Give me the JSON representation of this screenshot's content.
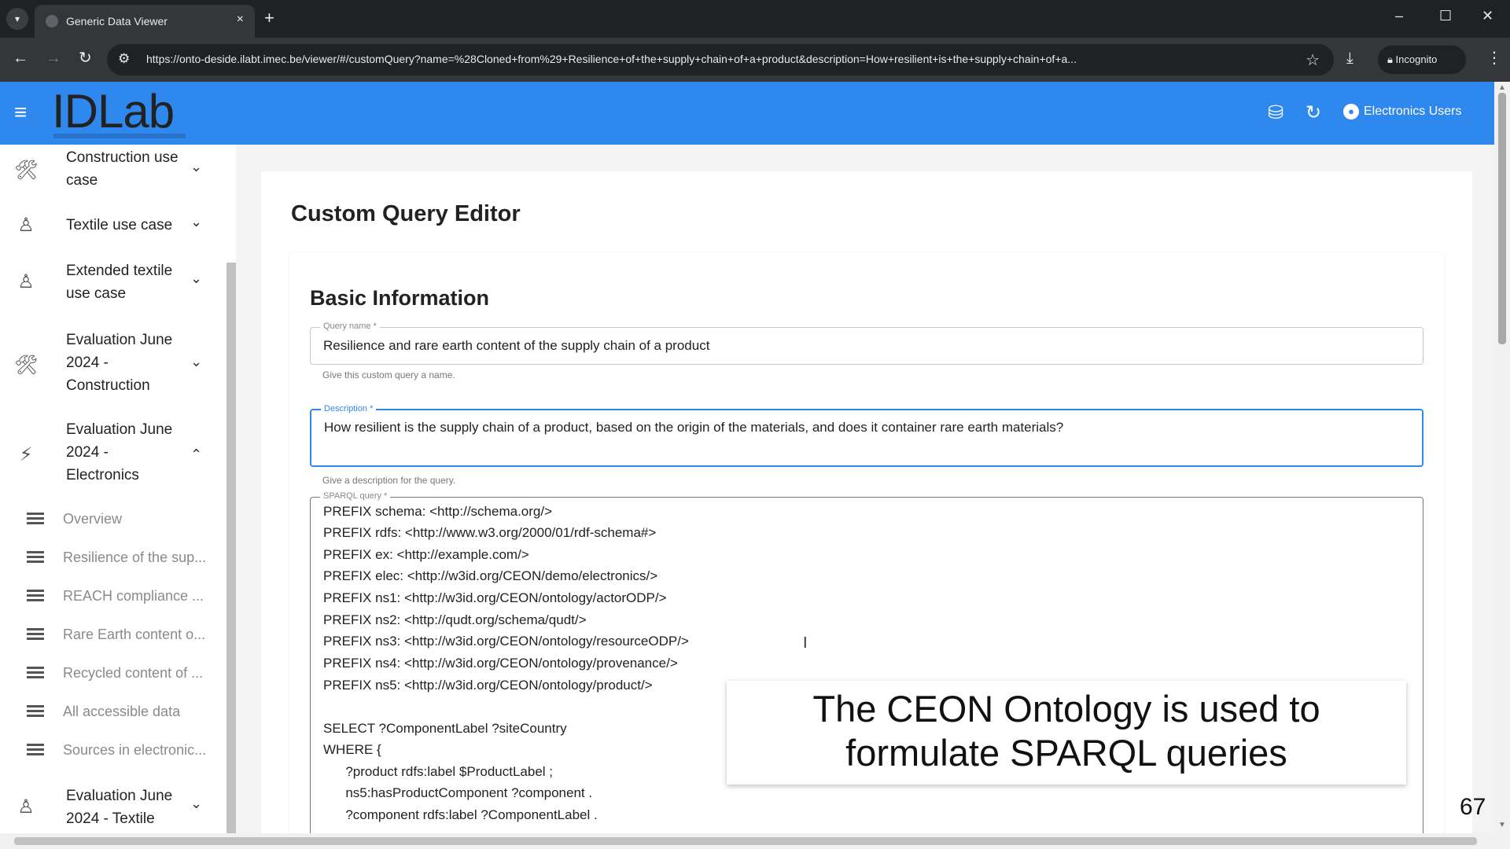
{
  "browser": {
    "tab_title": "Generic Data Viewer",
    "tab_close": "×",
    "new_tab": "+",
    "url": "https://onto-deside.ilabt.imec.be/viewer/#/customQuery?name=%28Cloned+from%29+Resilience+of+the+supply+chain+of+a+product&description=How+resilient+is+the+supply+chain+of+a...",
    "incognito_label": "Incognito",
    "minimize": "–",
    "maximize": "☐",
    "close": "✕"
  },
  "app": {
    "logo_text": "IDLab",
    "user_label": "Electronics Users",
    "icons": [
      "menu-icon",
      "database-icon",
      "refresh-icon",
      "account-circle-icon"
    ]
  },
  "sidebar": {
    "groups": [
      {
        "label_lines": [
          "Construction use",
          "case"
        ],
        "icon": "tools-icon",
        "icon_glyph": "🛠",
        "chevron": "⌄"
      },
      {
        "label_lines": [
          "Textile use case"
        ],
        "icon": "person-icon",
        "icon_glyph": "♙",
        "chevron": "⌄"
      },
      {
        "label_lines": [
          "Extended textile",
          "use case"
        ],
        "icon": "person-icon",
        "icon_glyph": "♙",
        "chevron": "⌄"
      },
      {
        "label_lines": [
          "Evaluation June",
          "2024 -",
          "Construction"
        ],
        "icon": "tools-icon",
        "icon_glyph": "🛠",
        "chevron": "⌄"
      },
      {
        "label_lines": [
          "Evaluation June",
          "2024 -",
          "Electronics"
        ],
        "icon": "bolt-icon",
        "icon_glyph": "⚡",
        "chevron": "⌃"
      },
      {
        "label_lines": [
          "Evaluation June",
          "2024 - Textile"
        ],
        "icon": "person-icon",
        "icon_glyph": "♙",
        "chevron": "⌄"
      }
    ],
    "items": [
      {
        "label": "Overview"
      },
      {
        "label": "Resilience of the sup..."
      },
      {
        "label": "REACH compliance ..."
      },
      {
        "label": "Rare Earth content o..."
      },
      {
        "label": "Recycled content of ..."
      },
      {
        "label": "All accessible data"
      },
      {
        "label": "Sources in electronic..."
      }
    ]
  },
  "editor": {
    "page_title": "Custom Query Editor",
    "section_title": "Basic Information",
    "query_name": {
      "legend": "Query name *",
      "value": "Resilience and rare earth content of the supply chain of a product",
      "help": "Give this custom query a name."
    },
    "description": {
      "legend": "Description *",
      "value": "How resilient is the supply chain of a product, based on the origin of the materials, and does it container rare earth materials?",
      "help": "Give a description for the query."
    },
    "sparql": {
      "legend": "SPARQL query *",
      "lines": [
        "PREFIX schema: <http://schema.org/>",
        "PREFIX rdfs: <http://www.w3.org/2000/01/rdf-schema#>",
        "PREFIX ex: <http://example.com/>",
        "PREFIX elec: <http://w3id.org/CEON/demo/electronics/>",
        "PREFIX ns1: <http://w3id.org/CEON/ontology/actorODP/>",
        "PREFIX ns2: <http://qudt.org/schema/qudt/>",
        "PREFIX ns3: <http://w3id.org/CEON/ontology/resourceODP/>",
        "PREFIX ns4: <http://w3id.org/CEON/ontology/provenance/>",
        "PREFIX ns5: <http://w3id.org/CEON/ontology/product/>",
        "",
        "SELECT ?ComponentLabel ?siteCountry",
        "WHERE {",
        "      ?product rdfs:label $ProductLabel ;",
        "      ns5:hasProductComponent ?component .",
        "      ?component rdfs:label ?ComponentLabel ."
      ]
    }
  },
  "caption": {
    "line1": "The CEON Ontology is used to",
    "line2": "formulate SPARQL queries"
  },
  "slide_number": "67"
}
